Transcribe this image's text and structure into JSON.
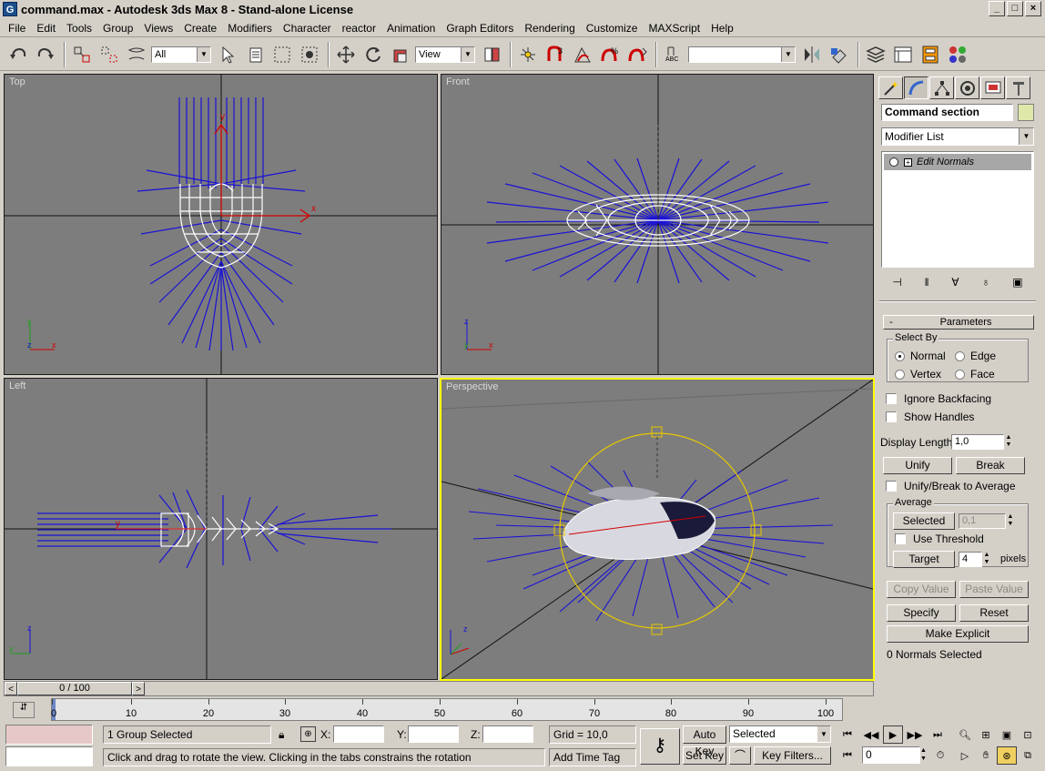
{
  "window": {
    "title": "command.max - Autodesk 3ds Max 8  - Stand-alone License",
    "app_icon_letter": "G",
    "min": "_",
    "max": "□",
    "close": "×"
  },
  "menu": [
    "File",
    "Edit",
    "Tools",
    "Group",
    "Views",
    "Create",
    "Modifiers",
    "Character",
    "reactor",
    "Animation",
    "Graph Editors",
    "Rendering",
    "Customize",
    "MAXScript",
    "Help"
  ],
  "toolbar": {
    "selection_filter": "All",
    "ref_coord": "View",
    "named_selection": ""
  },
  "viewports": {
    "top": "Top",
    "front": "Front",
    "left": "Left",
    "perspective": "Perspective"
  },
  "command_panel": {
    "object_name": "Command section",
    "object_color": "#dfe8a8",
    "modifier_list": "Modifier List",
    "stack_item": "Edit Normals",
    "parameters_title": "Parameters",
    "select_by": {
      "title": "Select By",
      "normal": "Normal",
      "edge": "Edge",
      "vertex": "Vertex",
      "face": "Face"
    },
    "ignore_backfacing": "Ignore Backfacing",
    "show_handles": "Show Handles",
    "display_length_label": "Display Length:",
    "display_length_value": "1,0",
    "unify": "Unify",
    "break": "Break",
    "unify_break_average": "Unify/Break to Average",
    "average": {
      "title": "Average",
      "selected_btn": "Selected",
      "selected_value": "0,1",
      "use_threshold": "Use Threshold",
      "target_btn": "Target",
      "target_value": "4",
      "pixels": "pixels"
    },
    "copy_value": "Copy Value",
    "paste_value": "Paste Value",
    "specify": "Specify",
    "reset": "Reset",
    "make_explicit": "Make Explicit",
    "normals_selected": "0 Normals Selected"
  },
  "time_slider": {
    "position": "0 / 100",
    "prev": "<",
    "next": ">"
  },
  "trackbar": {
    "ticks": [
      "0",
      "10",
      "20",
      "30",
      "40",
      "50",
      "60",
      "70",
      "80",
      "90",
      "100"
    ]
  },
  "status": {
    "selection": "1 Group Selected",
    "x_label": "X:",
    "y_label": "Y:",
    "z_label": "Z:",
    "grid": "Grid = 10,0",
    "prompt": "Click and drag to rotate the view.  Clicking in the tabs constrains the rotation",
    "add_time_tag": "Add Time Tag",
    "auto_key": "Auto Key",
    "set_key": "Set Key",
    "key_mode": "Selected",
    "key_filters": "Key Filters...",
    "frame": "0"
  }
}
